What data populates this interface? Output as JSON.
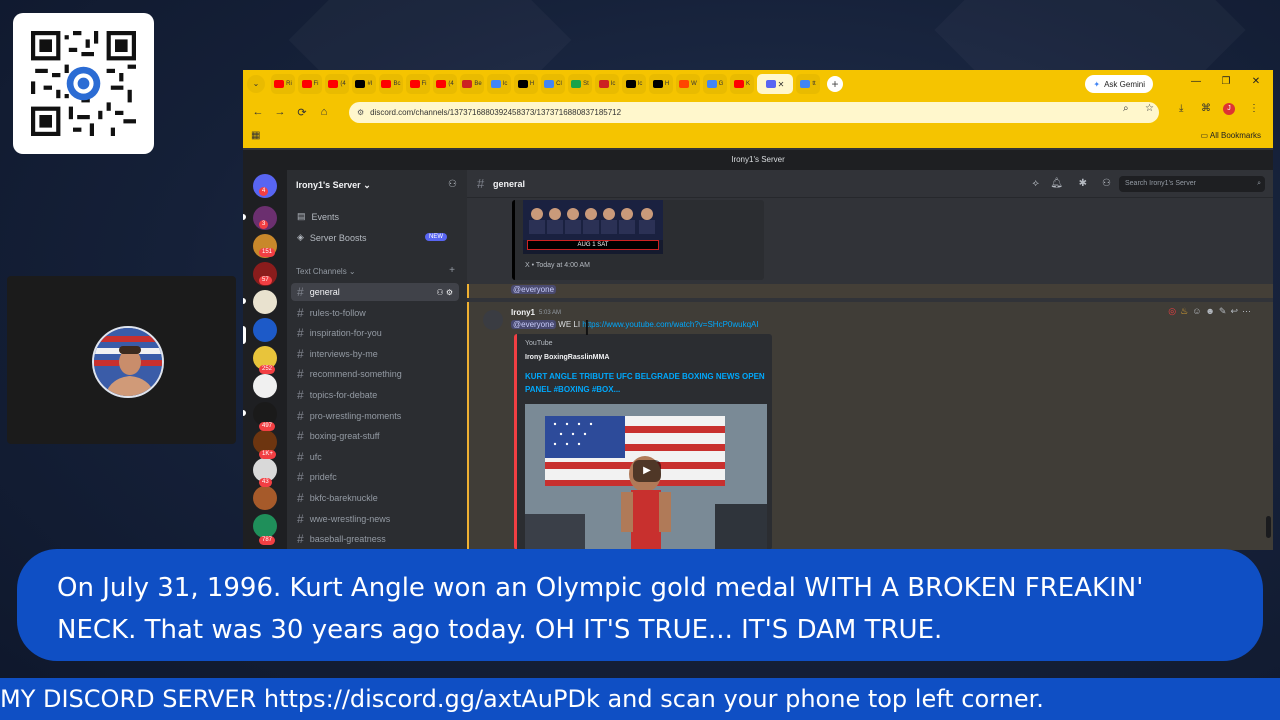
{
  "browser": {
    "tabs": [
      {
        "label": "Ri",
        "color": "#ff0000"
      },
      {
        "label": "Fi",
        "color": "#ff0000"
      },
      {
        "label": "(4",
        "color": "#ff0000"
      },
      {
        "label": "#I",
        "color": "#000000"
      },
      {
        "label": "Bc",
        "color": "#ff0000"
      },
      {
        "label": "Fi",
        "color": "#ff0000"
      },
      {
        "label": "(4",
        "color": "#ff0000"
      },
      {
        "label": "Be",
        "color": "#cc2222"
      },
      {
        "label": "Ic",
        "color": "#4285f4"
      },
      {
        "label": "H",
        "color": "#000000"
      },
      {
        "label": "Cl",
        "color": "#4285f4"
      },
      {
        "label": "St",
        "color": "#1aa34a"
      },
      {
        "label": "Ic",
        "color": "#cc2222"
      },
      {
        "label": "Ic",
        "color": "#000000"
      },
      {
        "label": "H",
        "color": "#000000"
      },
      {
        "label": "W",
        "color": "#ff4500"
      },
      {
        "label": "G",
        "color": "#4285f4"
      },
      {
        "label": "K",
        "color": "#ff0000"
      }
    ],
    "active_tab_close": "✕",
    "extra_tab": "tt",
    "new_tab": "+",
    "ask_gemini": "Ask Gemini",
    "url": "discord.com/channels/1373716880392458373/1373716880837185712",
    "all_bookmarks": "All Bookmarks",
    "accent": "#f5c400"
  },
  "discord": {
    "window_title": "Irony1's Server",
    "server_name": "Irony1's Server",
    "events": "Events",
    "server_boosts": "Server Boosts",
    "new_badge": "NEW",
    "category": "Text Channels",
    "channels": [
      "general",
      "rules-to-follow",
      "inspiration-for-you",
      "interviews-by-me",
      "recommend-something",
      "topics-for-debate",
      "pro-wrestling-moments",
      "boxing-great-stuff",
      "ufc",
      "pridefc",
      "bkfc-bareknuckle",
      "wwe-wrestling-news",
      "baseball-greatness"
    ],
    "server_badges": [
      "4",
      "3",
      "151",
      "57",
      "252",
      "497",
      "1K+",
      "43",
      "787"
    ],
    "chat_title": "general",
    "search_placeholder": "Search Irony1's Server",
    "embed1": {
      "date_label": "AUG 1 SAT",
      "source": "X • Today at 4:00 AM"
    },
    "mention": "@everyone",
    "message": {
      "author": "Irony1",
      "time": "5:03 AM",
      "mention": "@everyone",
      "text": "WE LI",
      "link": "https://www.youtube.com/watch?v=SHcP0wukqAI",
      "provider": "YouTube",
      "yt_author": "Irony BoxingRasslinMMA",
      "yt_title": "KURT ANGLE TRIBUTE UFC BELGRADE BOXING NEWS OPEN PANEL #BOXING #BOX..."
    }
  },
  "caption": "On July 31, 1996. Kurt Angle won an Olympic gold medal WITH A BROKEN FREAKIN' NECK. That was 30 years ago today. OH IT'S TRUE... IT'S DAM TRUE.",
  "ticker": "MY DISCORD SERVER https://discord.gg/axtAuPDk and scan your phone top left corner.",
  "colors": {
    "caption_bg": "#0f4fc4",
    "discord_bg": "#313338",
    "link": "#00a8fc"
  }
}
